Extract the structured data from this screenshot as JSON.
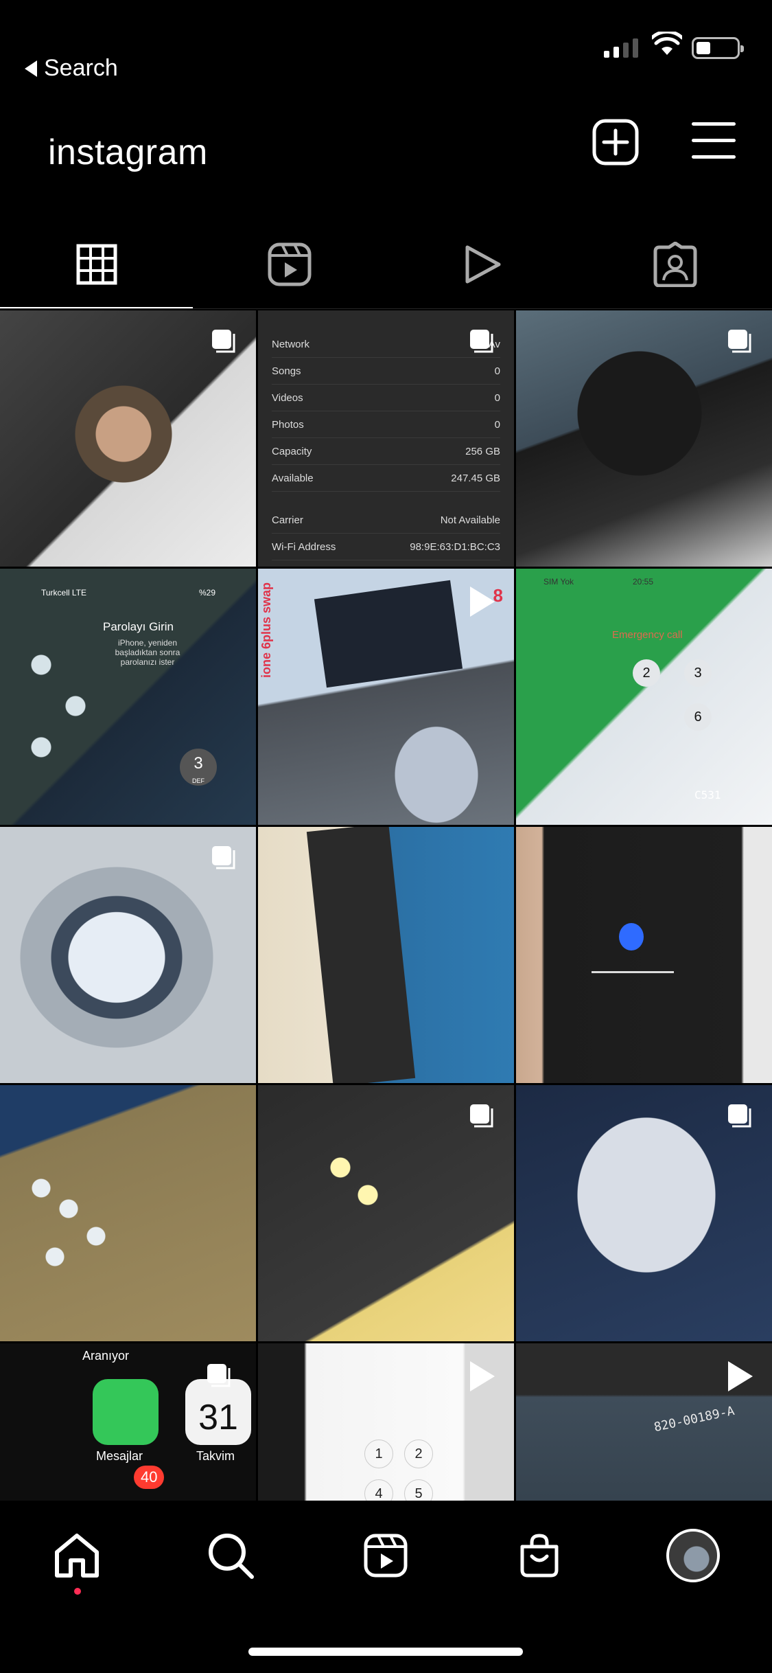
{
  "status_bar": {
    "back_label": "Search",
    "signal_icon": "cellular-signal-icon",
    "wifi_icon": "wifi-icon",
    "battery_icon": "battery-icon",
    "battery_level": 0.25
  },
  "header": {
    "title": "instagram",
    "new_post_icon": "plus-square-icon",
    "menu_icon": "hamburger-menu-icon"
  },
  "tabs": [
    {
      "name": "posts-grid",
      "icon": "grid-icon",
      "active": true
    },
    {
      "name": "reels",
      "icon": "reels-icon",
      "active": false
    },
    {
      "name": "videos",
      "icon": "play-icon",
      "active": false
    },
    {
      "name": "tagged",
      "icon": "tagged-person-icon",
      "active": false
    }
  ],
  "posts": {
    "p2": {
      "rows": [
        {
          "k": "Network",
          "v": "Not Av"
        },
        {
          "k": "Songs",
          "v": "0"
        },
        {
          "k": "Videos",
          "v": "0"
        },
        {
          "k": "Photos",
          "v": "0"
        },
        {
          "k": "Capacity",
          "v": "256 GB"
        },
        {
          "k": "Available",
          "v": "247.45 GB"
        },
        {
          "k": "Carrier",
          "v": "Not Available"
        },
        {
          "k": "Wi-Fi Address",
          "v": "98:9E:63:D1:BC:C3"
        }
      ]
    },
    "p4": {
      "carrier": "Turkcell  LTE",
      "battery": "%29",
      "title": "Parolayı Girin",
      "subtitle": "iPhone, yeniden başladıktan sonra parolanızı ister",
      "key": "3",
      "key_letters": "DEF"
    },
    "p5": {
      "overlay_text": "ione 6plus swap",
      "badge_number": "8"
    },
    "p6": {
      "sim": "SIM Yok",
      "time": "20:55",
      "emergency": "Emergency call",
      "keys": [
        "2",
        "3",
        "6"
      ],
      "board_label": "C531"
    },
    "p13": {
      "status": "Aranıyor",
      "app1": "Mesajlar",
      "app2_date": "31",
      "app2": "Takvim",
      "badge": "40"
    },
    "p14": {
      "keys": [
        "1",
        "2",
        "4",
        "5"
      ]
    },
    "p15": {
      "board_label": "820-00189-A"
    }
  },
  "bottom_nav": [
    {
      "name": "home",
      "icon": "home-icon",
      "active": true
    },
    {
      "name": "search",
      "icon": "search-icon",
      "active": false
    },
    {
      "name": "reels",
      "icon": "reels-icon",
      "active": false
    },
    {
      "name": "shop",
      "icon": "shopping-bag-icon",
      "active": false
    },
    {
      "name": "profile",
      "icon": "avatar",
      "active": false
    }
  ]
}
